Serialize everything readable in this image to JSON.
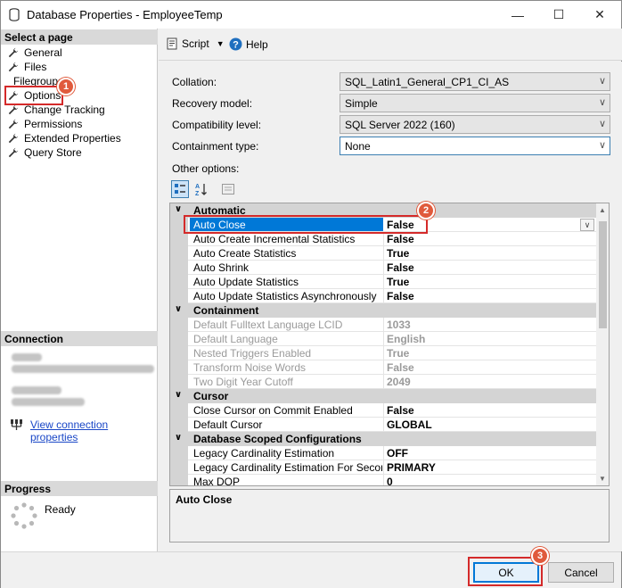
{
  "window": {
    "title": "Database Properties - EmployeeTemp"
  },
  "left": {
    "select_page_header": "Select a page",
    "pages": [
      {
        "label": "General"
      },
      {
        "label": "Files"
      },
      {
        "label": "Filegroups"
      },
      {
        "label": "Options"
      },
      {
        "label": "Change Tracking"
      },
      {
        "label": "Permissions"
      },
      {
        "label": "Extended Properties"
      },
      {
        "label": "Query Store"
      }
    ],
    "connection_header": "Connection",
    "view_connection_properties": "View connection properties",
    "progress_header": "Progress",
    "progress_status": "Ready"
  },
  "toolbar": {
    "script_label": "Script",
    "help_label": "Help"
  },
  "form": {
    "collation_label": "Collation:",
    "collation_value": "SQL_Latin1_General_CP1_CI_AS",
    "recovery_label": "Recovery model:",
    "recovery_value": "Simple",
    "compat_label": "Compatibility level:",
    "compat_value": "SQL Server 2022 (160)",
    "containment_label": "Containment type:",
    "containment_value": "None",
    "other_options_label": "Other options:"
  },
  "grid": {
    "automatic": "Automatic",
    "auto_close": {
      "name": "Auto Close",
      "value": "False"
    },
    "auto_create_incr": {
      "name": "Auto Create Incremental Statistics",
      "value": "False"
    },
    "auto_create_stats": {
      "name": "Auto Create Statistics",
      "value": "True"
    },
    "auto_shrink": {
      "name": "Auto Shrink",
      "value": "False"
    },
    "auto_update_stats": {
      "name": "Auto Update Statistics",
      "value": "True"
    },
    "auto_update_async": {
      "name": "Auto Update Statistics Asynchronously",
      "value": "False"
    },
    "containment": "Containment",
    "fulltext_lcid": {
      "name": "Default Fulltext Language LCID",
      "value": "1033"
    },
    "default_language": {
      "name": "Default Language",
      "value": "English"
    },
    "nested_triggers": {
      "name": "Nested Triggers Enabled",
      "value": "True"
    },
    "noise_words": {
      "name": "Transform Noise Words",
      "value": "False"
    },
    "two_digit_year": {
      "name": "Two Digit Year Cutoff",
      "value": "2049"
    },
    "cursor": "Cursor",
    "close_cursor": {
      "name": "Close Cursor on Commit Enabled",
      "value": "False"
    },
    "default_cursor": {
      "name": "Default Cursor",
      "value": "GLOBAL"
    },
    "db_scoped": "Database Scoped Configurations",
    "legacy_ce": {
      "name": "Legacy Cardinality Estimation",
      "value": "OFF"
    },
    "legacy_ce_secondary": {
      "name": "Legacy Cardinality Estimation For Secondary",
      "value": "PRIMARY"
    },
    "max_dop": {
      "name": "Max DOP",
      "value": "0"
    }
  },
  "description": {
    "title": "Auto Close"
  },
  "buttons": {
    "ok": "OK",
    "cancel": "Cancel"
  },
  "badges": {
    "one": "1",
    "two": "2",
    "three": "3"
  },
  "colors": {
    "accent": "#0078d7",
    "badge": "#e05a3c",
    "highlight_box": "#d42a2a",
    "link": "#1a47c7"
  }
}
